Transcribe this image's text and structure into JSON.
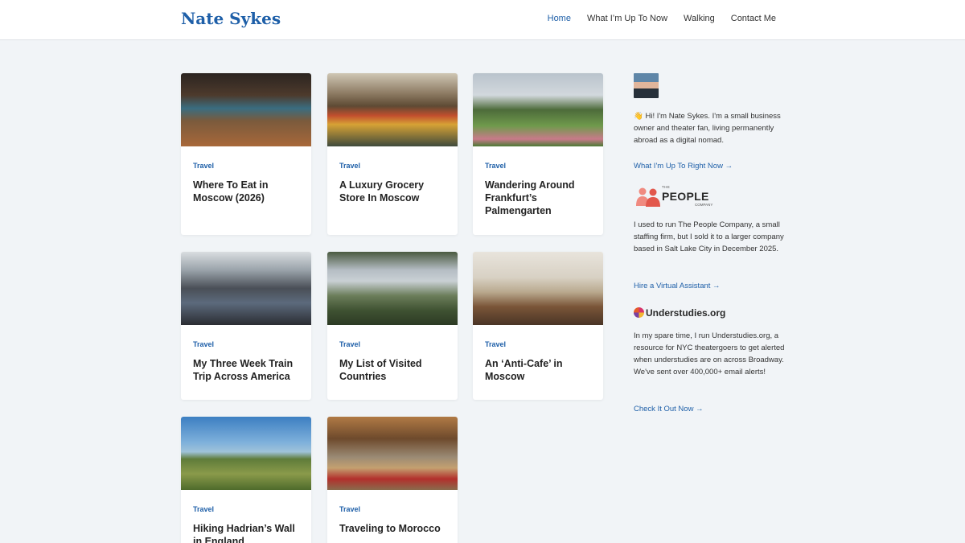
{
  "header": {
    "site_title": "Nate Sykes",
    "nav": [
      "Home",
      "What I’m Up To Now",
      "Walking",
      "Contact Me"
    ]
  },
  "posts": [
    {
      "category": "Travel",
      "title": "Where To Eat in Moscow (2026)"
    },
    {
      "category": "Travel",
      "title": "A Luxury Grocery Store In Moscow"
    },
    {
      "category": "Travel",
      "title": "Wandering Around Frankfurt’s Palmengarten"
    },
    {
      "category": "Travel",
      "title": "My Three Week Train Trip Across America"
    },
    {
      "category": "Travel",
      "title": "My List of Visited Countries"
    },
    {
      "category": "Travel",
      "title": "An ‘Anti-Cafe’ in Moscow"
    },
    {
      "category": "Travel",
      "title": "Hiking Hadrian’s Wall in England"
    },
    {
      "category": "Travel",
      "title": "Traveling to Morocco"
    }
  ],
  "sidebar": {
    "intro": "👋 Hi! I'm Nate Sykes. I'm a small business owner and theater fan, living permanently abroad as a digital nomad.",
    "now_link": "What I'm Up To Right Now →",
    "people_logo_small": "THE",
    "people_logo_name": "PEOPLE",
    "people_logo_sub": "COMPANY",
    "people_text": "I used to run The People Company, a small staffing firm, but I sold it to a larger company based in Salt Lake City in December 2025.",
    "assistant_link": "Hire a Virtual Assistant →",
    "understudies_logo": "Understudies.org",
    "understudies_text": "In my spare time, I run Understudies.org, a resource for NYC theatergoers to get alerted when understudies are on across Broadway. We've sent over 400,000+ email alerts!",
    "check_link": "Check It Out Now →"
  }
}
